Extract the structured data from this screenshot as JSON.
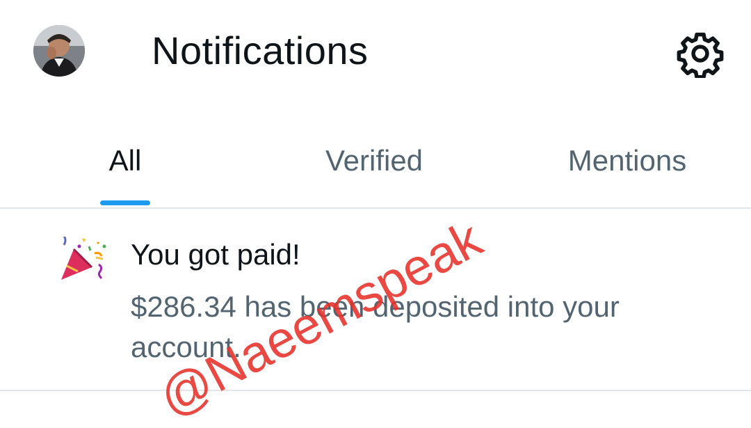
{
  "header": {
    "title": "Notifications",
    "avatar_icon": "profile-avatar",
    "settings_icon": "gear-icon"
  },
  "tabs": [
    {
      "label": "All",
      "active": true
    },
    {
      "label": "Verified",
      "active": false
    },
    {
      "label": "Mentions",
      "active": false
    }
  ],
  "notification": {
    "icon": "party-popper-icon",
    "title": "You got paid!",
    "body": "$286.34 has been deposited into your account."
  },
  "watermark": {
    "text": "@Naeemspeak"
  },
  "colors": {
    "accent": "#1d9bf0",
    "primary_text": "#0f1419",
    "secondary_text": "#536471",
    "watermark": "#e8312a"
  }
}
